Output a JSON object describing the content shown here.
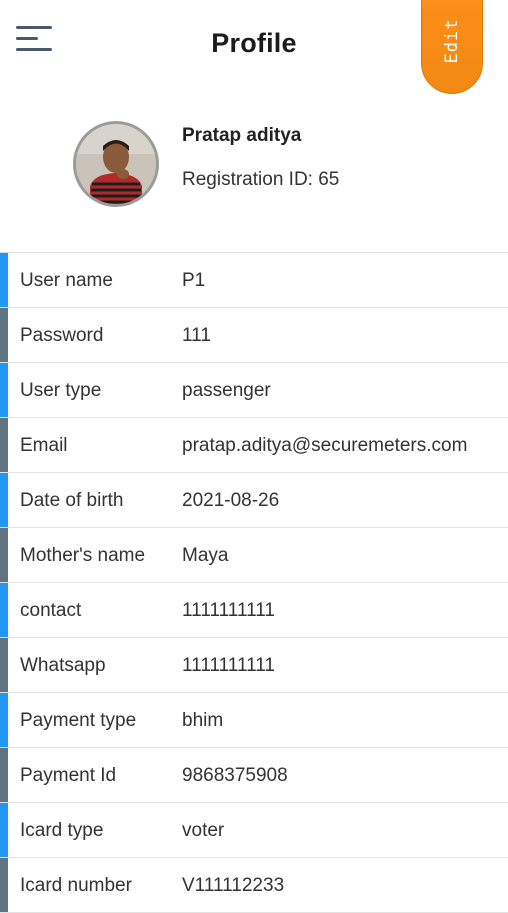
{
  "header": {
    "title": "Profile",
    "edit_label": "Edit",
    "menu_icon": "hamburger-menu-icon"
  },
  "profile": {
    "name": "Pratap aditya",
    "registration": "Registration ID: 65"
  },
  "colors": {
    "accent_blue": "#2196f3",
    "accent_slate": "#5f7480",
    "edit_orange": "#f7900f"
  },
  "details": {
    "rows": [
      {
        "label": "User name",
        "value": "P1",
        "accent": "blue"
      },
      {
        "label": "Password",
        "value": "111",
        "accent": "slate"
      },
      {
        "label": "User type",
        "value": "passenger",
        "accent": "blue"
      },
      {
        "label": "Email",
        "value": "pratap.aditya@securemeters.com",
        "accent": "slate"
      },
      {
        "label": "Date of birth",
        "value": "2021-08-26",
        "accent": "blue"
      },
      {
        "label": "Mother's name",
        "value": "Maya",
        "accent": "slate"
      },
      {
        "label": "contact",
        "value": "1111111111",
        "accent": "blue"
      },
      {
        "label": "Whatsapp",
        "value": "1111111111",
        "accent": "slate"
      },
      {
        "label": "Payment type",
        "value": "bhim",
        "accent": "blue"
      },
      {
        "label": "Payment Id",
        "value": "9868375908",
        "accent": "slate"
      },
      {
        "label": "Icard type",
        "value": "voter",
        "accent": "blue"
      },
      {
        "label": "Icard number",
        "value": "V111112233",
        "accent": "slate"
      }
    ]
  }
}
